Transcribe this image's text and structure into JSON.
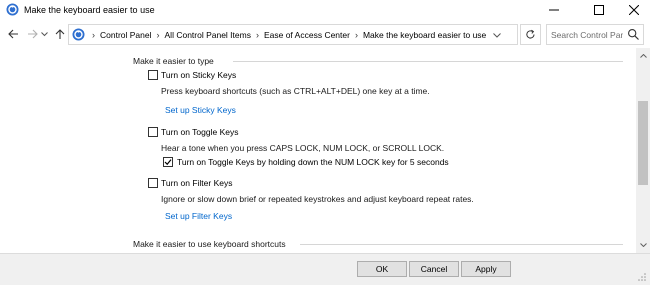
{
  "window": {
    "title": "Make the keyboard easier to use",
    "icons": {
      "app": "ease-of-access-icon",
      "minimize": "minimize-icon",
      "maximize": "maximize-icon",
      "close": "close-icon"
    }
  },
  "nav": {
    "breadcrumbs": [
      "Control Panel",
      "All Control Panel Items",
      "Ease of Access Center",
      "Make the keyboard easier to use"
    ],
    "search_placeholder": "Search Control Panel",
    "icons": {
      "back": "back-arrow-icon",
      "forward": "forward-arrow-icon",
      "recent": "recent-dropdown-icon",
      "up": "up-arrow-icon",
      "refresh": "refresh-icon",
      "search": "search-icon"
    }
  },
  "content": {
    "section1_heading": "Make it easier to type",
    "sticky": {
      "label": "Turn on Sticky Keys",
      "checked": false,
      "description": "Press keyboard shortcuts (such as CTRL+ALT+DEL) one key at a time.",
      "link": "Set up Sticky Keys"
    },
    "toggle": {
      "label": "Turn on Toggle Keys",
      "checked": false,
      "description": "Hear a tone when you press CAPS LOCK, NUM LOCK, or SCROLL LOCK.",
      "sub_label": "Turn on Toggle Keys by holding down the NUM LOCK key for 5 seconds",
      "sub_checked": true
    },
    "filter": {
      "label": "Turn on Filter Keys",
      "checked": false,
      "description": "Ignore or slow down brief or repeated keystrokes and adjust keyboard repeat rates.",
      "link": "Set up Filter Keys"
    },
    "section2_heading": "Make it easier to use keyboard shortcuts"
  },
  "footer": {
    "ok": "OK",
    "cancel": "Cancel",
    "apply": "Apply"
  },
  "colors": {
    "link": "#0066cc",
    "footer_bg": "#f0f0f0",
    "scroll_thumb": "#c2c2c2"
  }
}
